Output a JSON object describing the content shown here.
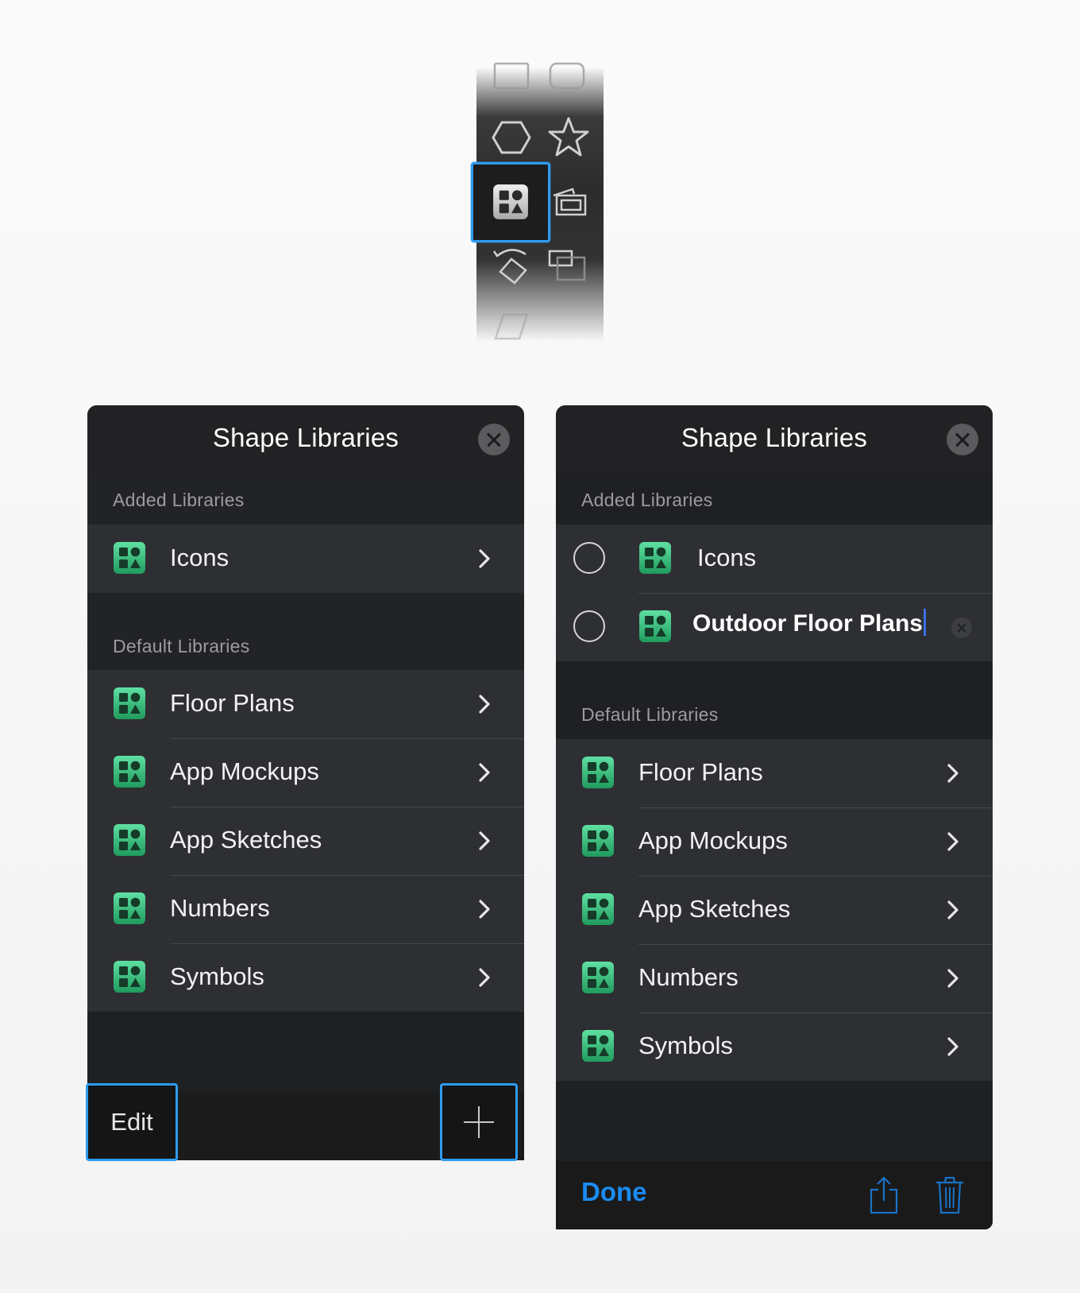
{
  "toolbar": {
    "tools": [
      {
        "name": "rectangle-tool",
        "icon": "rectangle-icon"
      },
      {
        "name": "rounded-rect-tool",
        "icon": "rounded-rectangle-icon"
      },
      {
        "name": "hexagon-tool",
        "icon": "hexagon-icon"
      },
      {
        "name": "star-tool",
        "icon": "star-icon"
      },
      {
        "name": "shape-library-tool",
        "icon": "shape-library-icon",
        "selected": true
      },
      {
        "name": "stencil-tool",
        "icon": "stacked-frames-icon"
      },
      {
        "name": "rotate-tool",
        "icon": "rotate-shape-icon"
      },
      {
        "name": "arrange-tool",
        "icon": "arrange-icon"
      }
    ]
  },
  "colors": {
    "accent": "#2d9cf0",
    "done": "#1a8cf2",
    "panel_bg": "#1f2022",
    "row_bg": "#2e2f33",
    "icon_green": "#33c27a"
  },
  "left": {
    "title": "Shape Libraries",
    "added_header": "Added Libraries",
    "added": [
      {
        "label": "Icons"
      }
    ],
    "default_header": "Default Libraries",
    "defaults": [
      {
        "label": "Floor Plans"
      },
      {
        "label": "App Mockups"
      },
      {
        "label": "App Sketches"
      },
      {
        "label": "Numbers"
      },
      {
        "label": "Symbols"
      }
    ],
    "edit_label": "Edit"
  },
  "right": {
    "title": "Shape Libraries",
    "added_header": "Added Libraries",
    "added": [
      {
        "label": "Icons"
      }
    ],
    "editing_value": "Outdoor Floor Plans",
    "default_header": "Default Libraries",
    "defaults": [
      {
        "label": "Floor Plans"
      },
      {
        "label": "App Mockups"
      },
      {
        "label": "App Sketches"
      },
      {
        "label": "Numbers"
      },
      {
        "label": "Symbols"
      }
    ],
    "done_label": "Done"
  }
}
